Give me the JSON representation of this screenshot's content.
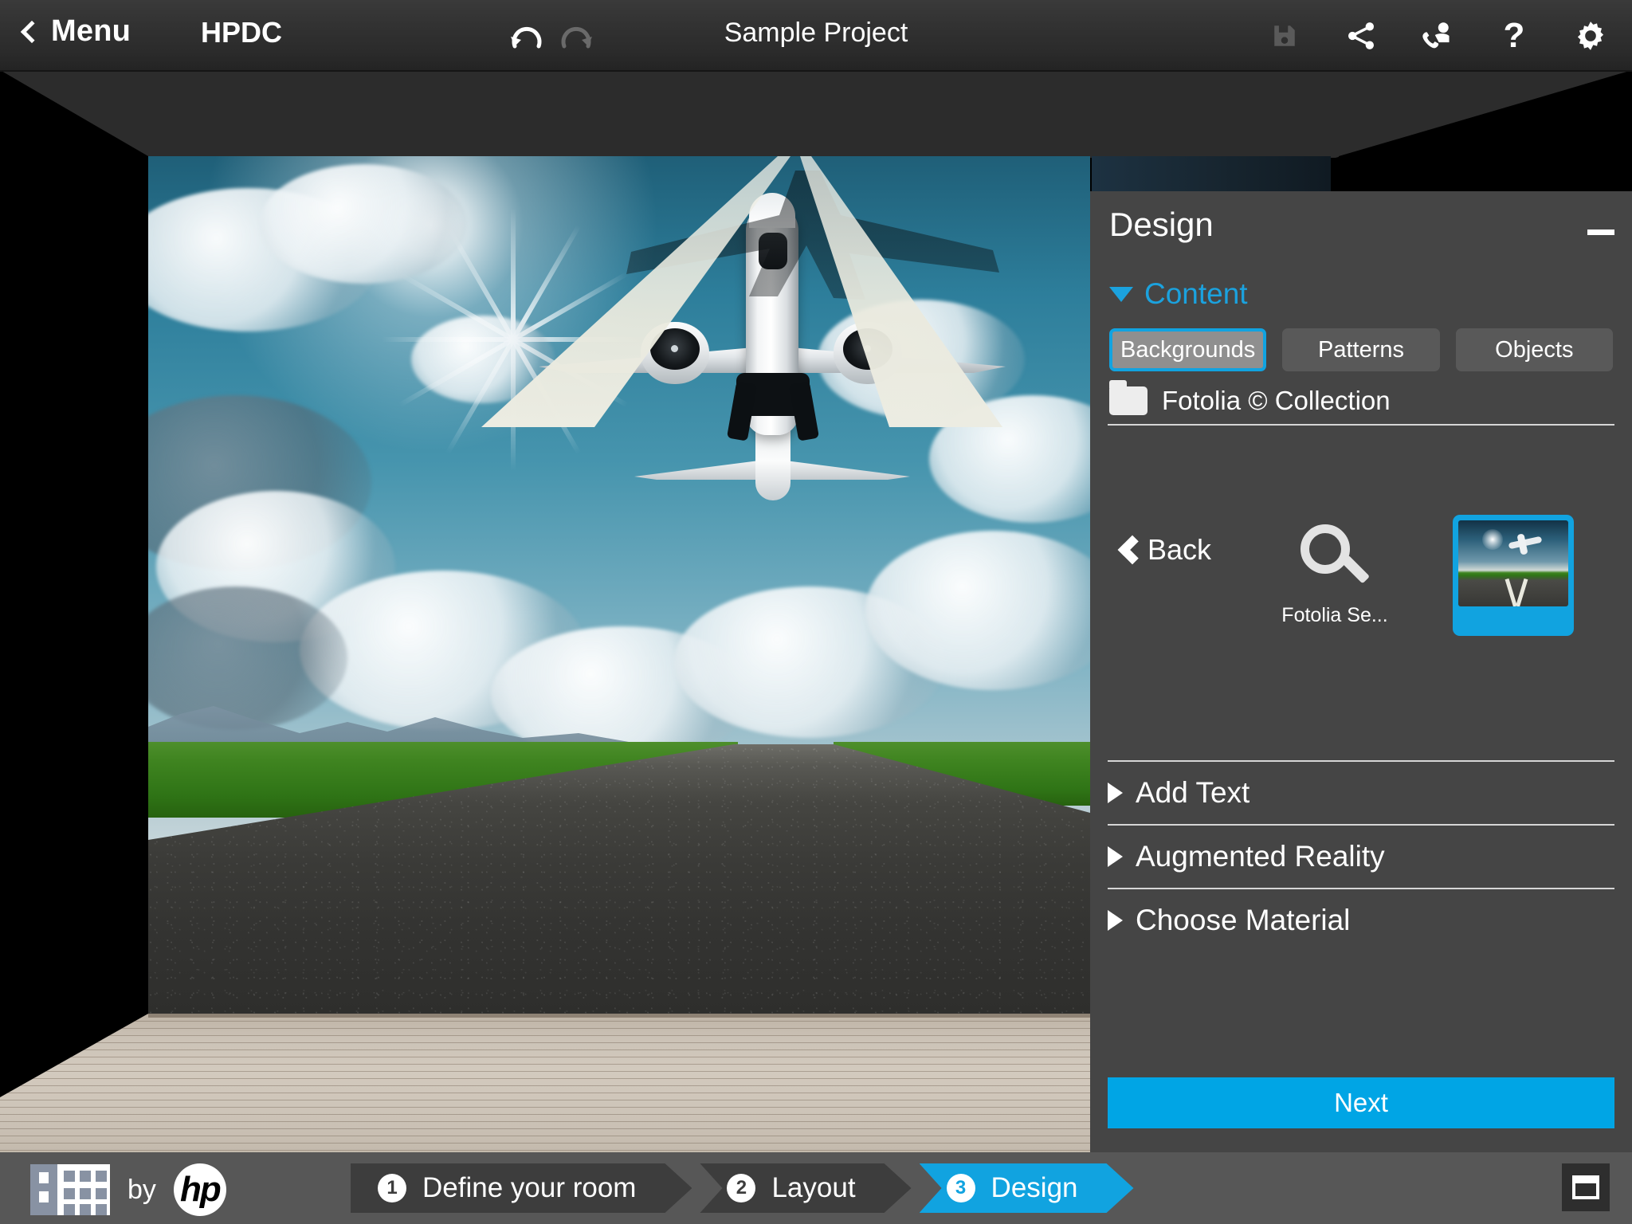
{
  "topbar": {
    "menu_label": "Menu",
    "brand": "HPDC",
    "project_title": "Sample Project",
    "undo_icon": "undo-arrow-icon",
    "redo_icon": "redo-arrow-icon",
    "icons": [
      {
        "name": "save-icon",
        "glyph": "▣",
        "state": "disabled"
      },
      {
        "name": "share-icon",
        "glyph": "",
        "state": "enabled"
      },
      {
        "name": "contact-support-icon",
        "glyph": "",
        "state": "enabled"
      },
      {
        "name": "help-icon",
        "glyph": "?",
        "state": "enabled"
      },
      {
        "name": "settings-gear-icon",
        "glyph": "",
        "state": "enabled"
      }
    ]
  },
  "panel": {
    "title": "Design",
    "minimize_label": "—",
    "content_section": {
      "label": "Content",
      "expanded": true,
      "tabs": [
        {
          "label": "Backgrounds",
          "active": true
        },
        {
          "label": "Patterns",
          "active": false
        },
        {
          "label": "Objects",
          "active": false
        }
      ],
      "breadcrumb": "Fotolia © Collection",
      "back_label": "Back",
      "items": [
        {
          "label": "Fotolia Se...",
          "type": "search",
          "selected": false
        },
        {
          "label": "",
          "type": "thumbnail",
          "selected": true
        }
      ]
    },
    "sections": [
      {
        "label": "Add Text",
        "expanded": false
      },
      {
        "label": "Augmented Reality",
        "expanded": false
      },
      {
        "label": "Choose Material",
        "expanded": false
      }
    ],
    "next_label": "Next"
  },
  "bottombar": {
    "by_label": "by",
    "hp_label": "hp",
    "steps": [
      {
        "num": "1",
        "label": "Define your room",
        "active": false
      },
      {
        "num": "2",
        "label": "Layout",
        "active": false
      },
      {
        "num": "3",
        "label": "Design",
        "active": true
      }
    ],
    "toggle_icon": "panel-toggle-icon"
  },
  "colors": {
    "accent_blue": "#11a3e0",
    "next_blue": "#00a5e5",
    "panel_bg": "#454545",
    "topbar_bg": "#2f2f2f",
    "bottombar_bg": "#575757"
  }
}
